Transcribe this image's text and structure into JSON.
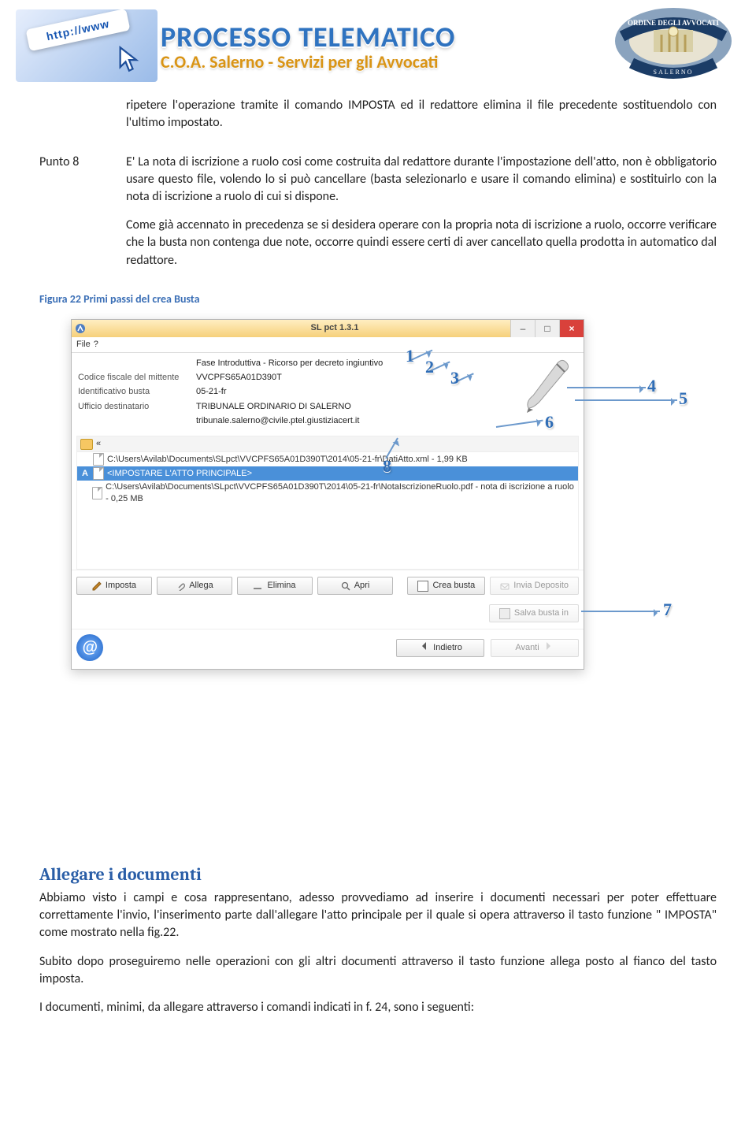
{
  "header": {
    "title": "PROCESSO TELEMATICO",
    "subtitle": "C.O.A. Salerno - Servizi per gli Avvocati",
    "logo_text": "http://www"
  },
  "body": {
    "intro": "ripetere l'operazione tramite il comando IMPOSTA ed il redattore elimina il file precedente sostituendolo con l'ultimo impostato.",
    "punto_label": "Punto 8",
    "punto_text": "E' La nota di iscrizione a ruolo cosi come costruita dal redattore durante l'impostazione dell'atto, non è obbligatorio usare questo file, volendo lo si può cancellare (basta selezionarlo e usare il comando elimina) e sostituirlo con la nota di iscrizione a ruolo di cui si dispone.",
    "punto_text2": "Come già accennato in precedenza se si desidera operare con la propria nota di iscrizione a ruolo, occorre verificare che la busta non contenga due note, occorre quindi essere certi di aver cancellato quella prodotta in automatico dal redattore.",
    "fig_caption": "Figura 22 Primi passi del crea Busta"
  },
  "win": {
    "title": "SL pct 1.3.1",
    "menu": {
      "file": "File",
      "help": "?"
    },
    "info": {
      "row0": {
        "val": "Fase Introduttiva - Ricorso per decreto ingiuntivo"
      },
      "row1": {
        "lab": "Codice fiscale del mittente",
        "val": "VVCPFS65A01D390T"
      },
      "row2": {
        "lab": "Identificativo busta",
        "val": "05-21-fr"
      },
      "row3": {
        "lab": "Ufficio destinatario",
        "val": "TRIBUNALE ORDINARIO DI SALERNO"
      },
      "row4": {
        "val": "tribunale.salerno@civile.ptel.giustiziacert.it"
      }
    },
    "list": {
      "crumb": "«",
      "i0": "C:\\Users\\Avilab\\Documents\\SLpct\\VVCPFS65A01D390T\\2014\\05-21-fr\\DatiAtto.xml - 1,99 KB",
      "i1": "<IMPOSTARE L'ATTO PRINCIPALE>",
      "i1_letter": "A",
      "i2": "C:\\Users\\Avilab\\Documents\\SLpct\\VVCPFS65A01D390T\\2014\\05-21-fr\\NotaIscrizioneRuolo.pdf - nota di iscrizione a ruolo - 0,25 MB"
    },
    "buttons": {
      "imposta": "Imposta",
      "allega": "Allega",
      "elimina": "Elimina",
      "apri": "Apri",
      "crea": "Crea busta",
      "invia": "Invia Deposito",
      "salva": "Salva busta in",
      "indietro": "Indietro",
      "avanti": "Avanti"
    }
  },
  "annotations": {
    "n1": "1",
    "n2": "2",
    "n3": "3",
    "n4": "4",
    "n5": "5",
    "n6": "6",
    "n7": "7",
    "n8": "8"
  },
  "section": {
    "heading": "Allegare i documenti",
    "p1": "Abbiamo visto i campi e cosa rappresentano, adesso provvediamo ad inserire i documenti necessari per poter effettuare correttamente l'invio, l'inserimento parte dall'allegare l'atto principale per il quale si opera attraverso il tasto funzione \" IMPOSTA\" come mostrato nella fig.22.",
    "p2": "Subito dopo proseguiremo nelle operazioni con gli altri documenti attraverso il tasto funzione allega posto al fianco del tasto imposta.",
    "p3": "I documenti, minimi, da allegare attraverso i comandi indicati in f. 24,  sono i seguenti:"
  }
}
